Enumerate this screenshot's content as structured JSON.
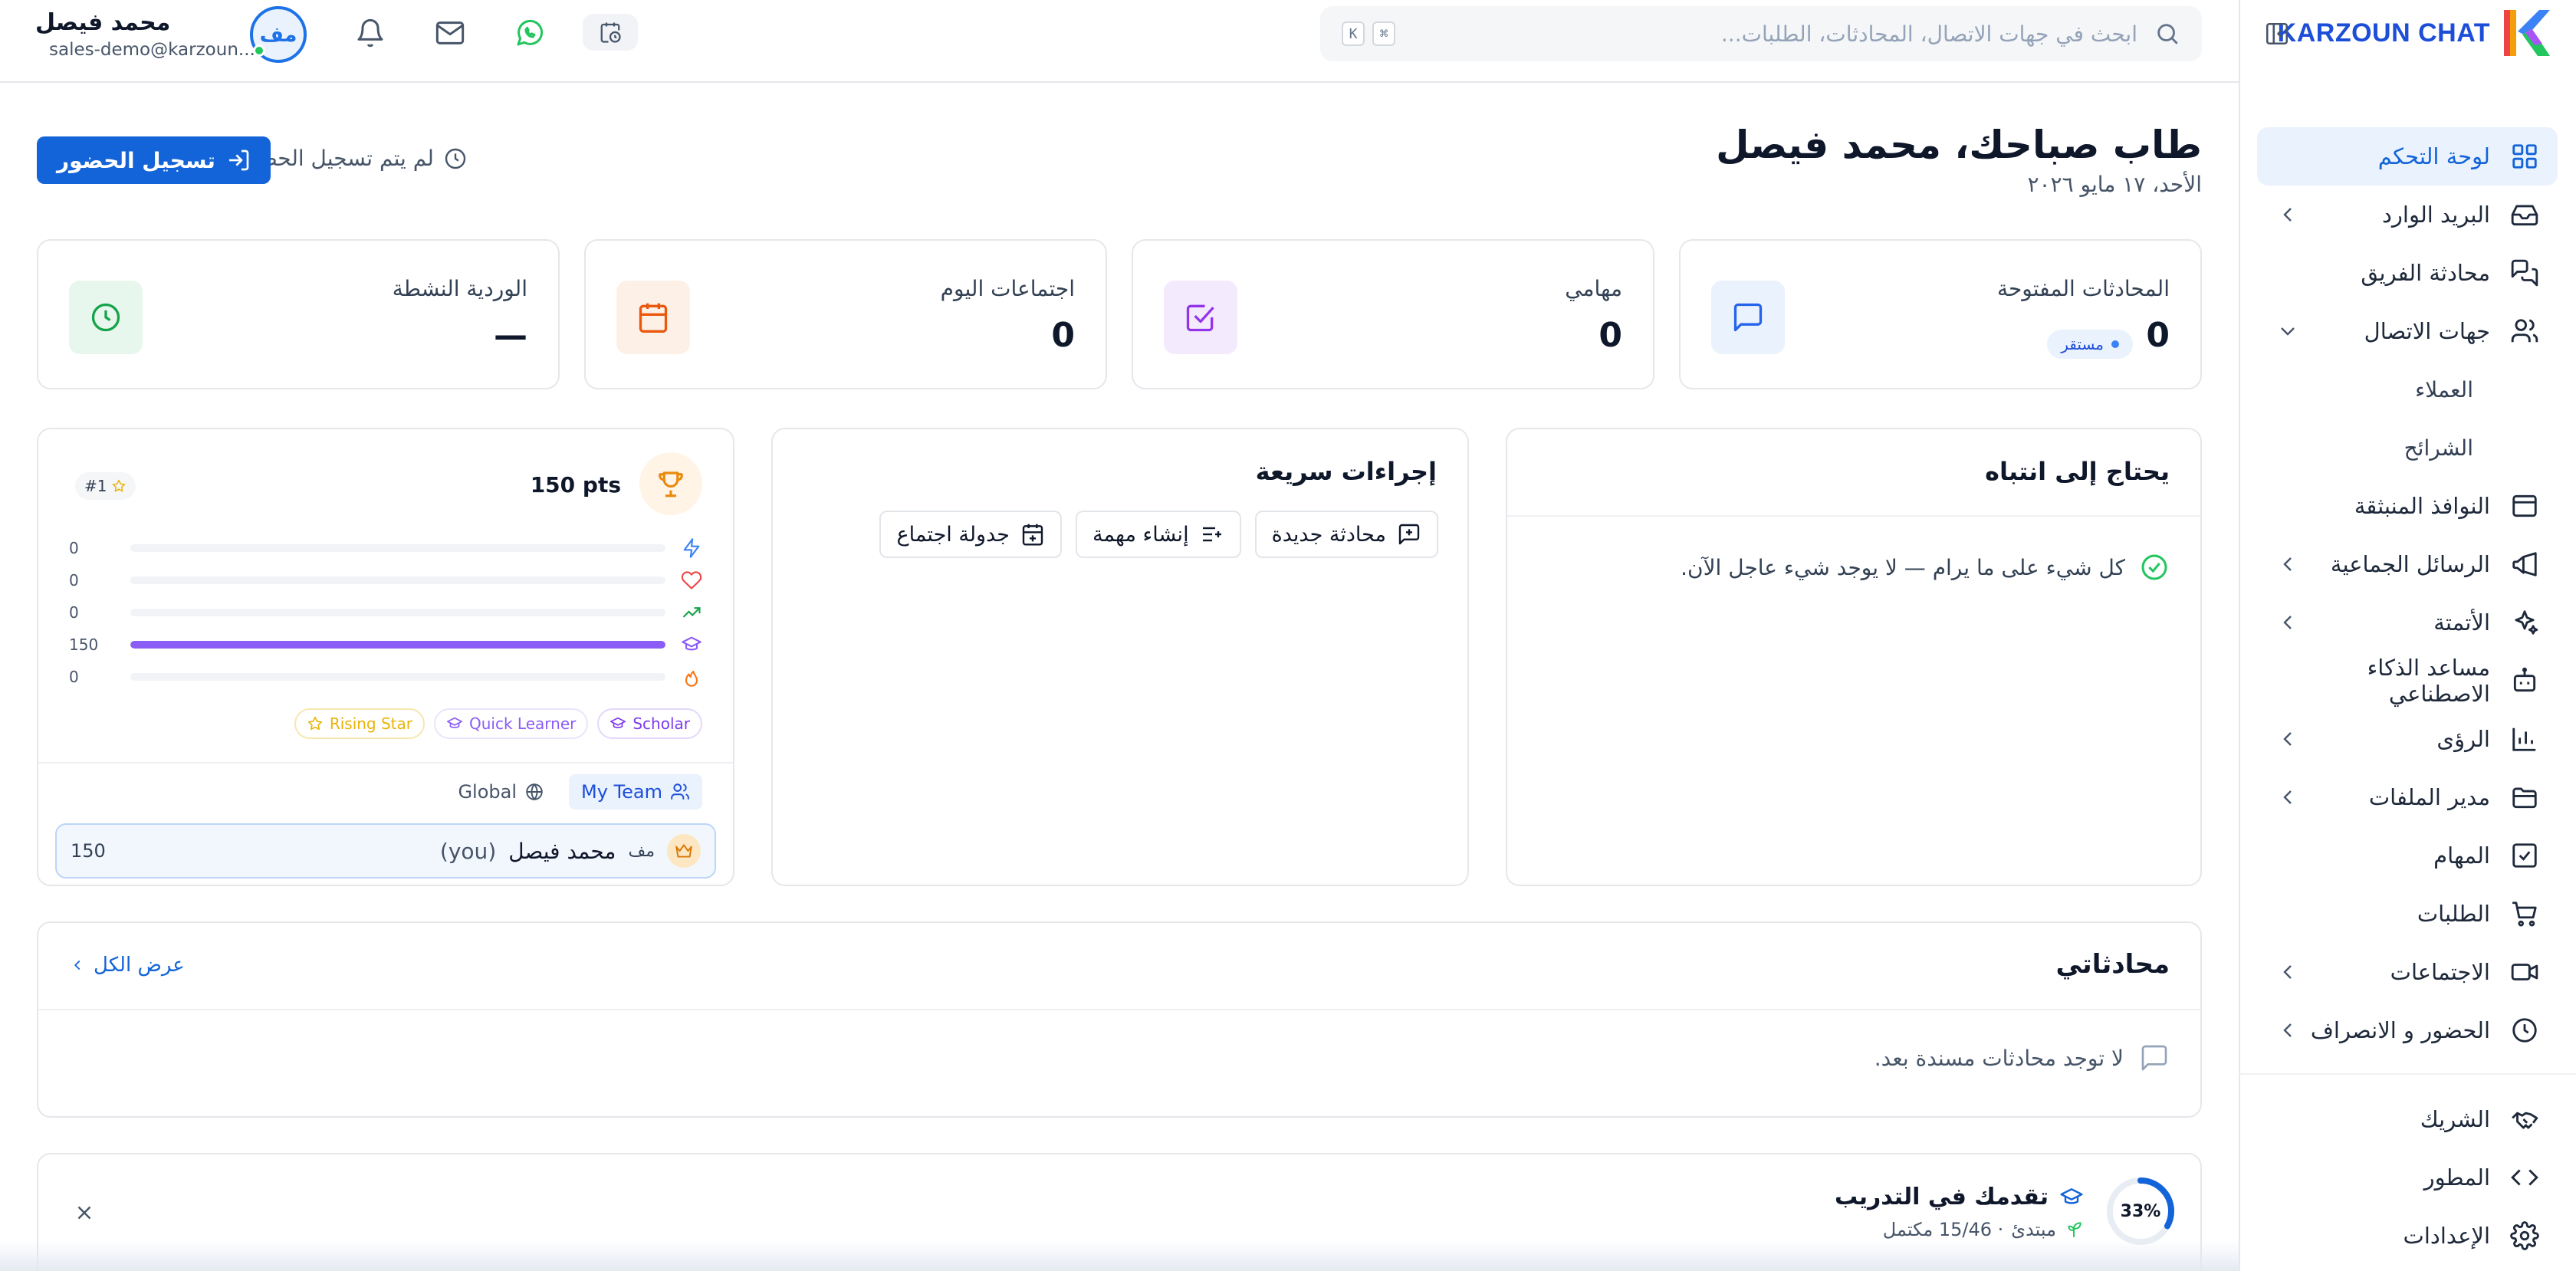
{
  "brand": {
    "name": "KARZOUN CHAT"
  },
  "search": {
    "placeholder": "ابحث في جهات الاتصال، المحادثات، الطلبات...",
    "kbd1": "⌘",
    "kbd2": "K"
  },
  "user": {
    "name": "محمد فيصل",
    "email": "sales-demo@karzoun...",
    "initials": "مف"
  },
  "sidebar": {
    "items": [
      {
        "label": "لوحة التحكم",
        "icon": "dashboard-icon",
        "active": true
      },
      {
        "label": "البريد الوارد",
        "icon": "inbox-icon"
      },
      {
        "label": "محادثة الفريق",
        "icon": "team-chat-icon"
      },
      {
        "label": "جهات الاتصال",
        "icon": "contacts-icon"
      },
      {
        "label": "العملاء"
      },
      {
        "label": "الشرائح"
      },
      {
        "label": "النوافذ المنبثقة",
        "icon": "popup-icon"
      },
      {
        "label": "الرسائل الجماعية",
        "icon": "megaphone-icon"
      },
      {
        "label": "الأتمتة",
        "icon": "sparkles-icon"
      },
      {
        "label": "مساعد الذكاء الاصطناعي",
        "icon": "bot-icon"
      },
      {
        "label": "الرؤى",
        "icon": "chart-icon"
      },
      {
        "label": "مدير الملفات",
        "icon": "folder-icon"
      },
      {
        "label": "المهام",
        "icon": "task-icon"
      },
      {
        "label": "الطلبات",
        "icon": "cart-icon"
      },
      {
        "label": "الاجتماعات",
        "icon": "video-icon"
      },
      {
        "label": "الحضور و الانصراف",
        "icon": "clock-icon"
      },
      {
        "label": "الشريك",
        "icon": "handshake-icon"
      },
      {
        "label": "المطور",
        "icon": "code-icon"
      },
      {
        "label": "الإعدادات",
        "icon": "settings-icon"
      }
    ]
  },
  "header": {
    "greeting": "طاب صباحك، محمد فيصل",
    "date": "الأحد، ١٧ مايو ٢٠٢٦",
    "not_checked": "لم يتم تسجيل الحضور",
    "checkin": "تسجيل الحضور"
  },
  "stats": [
    {
      "label": "المحادثات المفتوحة",
      "value": "0",
      "badge": "مستقر",
      "color": "#2563eb",
      "bg": "#eaf2fd"
    },
    {
      "label": "مهامي",
      "value": "0",
      "color": "#9333ea",
      "bg": "#f3ebfd"
    },
    {
      "label": "اجتماعات اليوم",
      "value": "0",
      "color": "#ea580c",
      "bg": "#fdf0e6"
    },
    {
      "label": "الوردية النشطة",
      "value": "—",
      "color": "#16a34a",
      "bg": "#e8f7ee"
    }
  ],
  "attention": {
    "title": "يحتاج إلى انتباه",
    "message": "كل شيء على ما يرام — لا يوجد شيء عاجل الآن."
  },
  "quick_actions": {
    "title": "إجراءات سريعة",
    "new_chat": "محادثة جديدة",
    "new_task": "إنشاء مهمة",
    "schedule": "جدولة اجتماع"
  },
  "gamification": {
    "points": "150 pts",
    "rank": "#1",
    "bars": [
      {
        "icon": "bolt-icon",
        "value": 0,
        "label": "0",
        "color": "#3b82f6"
      },
      {
        "icon": "heart-icon",
        "value": 0,
        "label": "0",
        "color": "#ef4444"
      },
      {
        "icon": "trend-icon",
        "value": 0,
        "label": "0",
        "color": "#16a34a"
      },
      {
        "icon": "cap-icon",
        "value": 1,
        "label": "150",
        "color": "#8b5cf6"
      },
      {
        "icon": "flame-icon",
        "value": 0,
        "label": "0",
        "color": "#f97316"
      }
    ],
    "badges": [
      {
        "label": "Scholar",
        "color": "#7c3aed",
        "border": "#e4d7fb"
      },
      {
        "label": "Quick Learner",
        "color": "#8b5cf6",
        "border": "#ebe4fb"
      },
      {
        "label": "Rising Star",
        "color": "#eab308",
        "border": "#f6e7b0"
      }
    ],
    "tab_team": "My Team",
    "tab_global": "Global",
    "leader": {
      "initials": "مف",
      "name": "محمد فيصل",
      "you": "(you)",
      "points": "150"
    }
  },
  "conversations": {
    "title": "محادثاتي",
    "view_all": "عرض الكل",
    "empty": "لا توجد محادثات مسندة بعد."
  },
  "training": {
    "title": "تقدمك في التدريب",
    "level": "مبتدئ",
    "progress_text": "· 15/46 مكتمل",
    "percent": "33%",
    "progress": 0.33
  }
}
